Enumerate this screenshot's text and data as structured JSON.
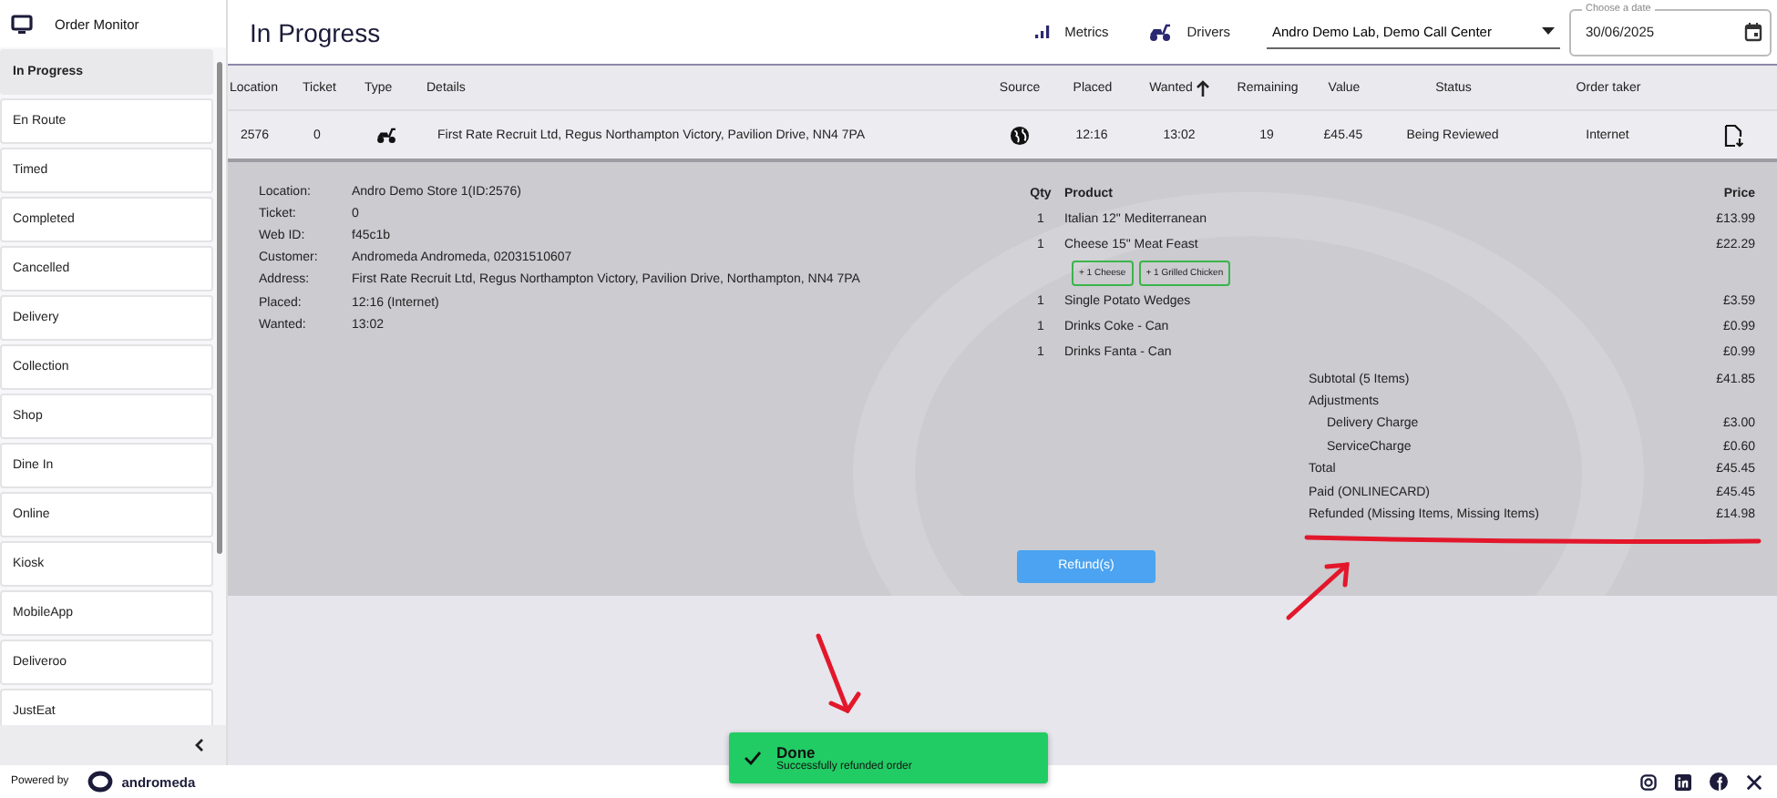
{
  "sidebar": {
    "title": "Order Monitor",
    "items": [
      {
        "label": "In Progress",
        "selected": true
      },
      {
        "label": "En Route",
        "selected": false
      },
      {
        "label": "Timed",
        "selected": false
      },
      {
        "label": "Completed",
        "selected": false
      },
      {
        "label": "Cancelled",
        "selected": false
      },
      {
        "label": "Delivery",
        "selected": false
      },
      {
        "label": "Collection",
        "selected": false
      },
      {
        "label": "Shop",
        "selected": false
      },
      {
        "label": "Dine In",
        "selected": false
      },
      {
        "label": "Online",
        "selected": false
      },
      {
        "label": "Kiosk",
        "selected": false
      },
      {
        "label": "MobileApp",
        "selected": false
      },
      {
        "label": "Deliveroo",
        "selected": false
      },
      {
        "label": "JustEat",
        "selected": false
      }
    ]
  },
  "header": {
    "title": "In Progress",
    "metrics": "Metrics",
    "drivers": "Drivers",
    "store_select": "Andro Demo Lab, Demo Call Center",
    "date_field": {
      "label": "Choose a date",
      "value": "30/06/2025"
    }
  },
  "table": {
    "columns": [
      "Location",
      "Ticket",
      "Type",
      "Details",
      "Source",
      "Placed",
      "Wanted",
      "Remaining",
      "Value",
      "Status",
      "Order taker"
    ],
    "rows": [
      {
        "location": "2576",
        "ticket": "0",
        "details": "First Rate Recruit Ltd, Regus Northampton Victory, Pavilion Drive, NN4 7PA",
        "placed": "12:16",
        "wanted": "13:02",
        "remaining": "19",
        "value": "£45.45",
        "status": "Being Reviewed",
        "order_taker": "Internet"
      }
    ]
  },
  "order_details": {
    "fields": [
      {
        "label": "Location:",
        "value": "Andro Demo Store 1(ID:2576)"
      },
      {
        "label": "Ticket:",
        "value": "0"
      },
      {
        "label": "Web ID:",
        "value": "f45c1b"
      },
      {
        "label": "Customer:",
        "value": "Andromeda Andromeda, 02031510607"
      },
      {
        "label": "Address:",
        "value": "First Rate Recruit Ltd, Regus Northampton Victory, Pavilion Drive, Northampton, NN4 7PA"
      },
      {
        "label": "Placed:",
        "value": "12:16  (Internet)"
      },
      {
        "label": "Wanted:",
        "value": "13:02"
      }
    ],
    "items_header": {
      "qty": "Qty",
      "product": "Product",
      "price": "Price"
    },
    "items": [
      {
        "qty": "1",
        "product": "Italian 12\" Mediterranean",
        "price": "£13.99"
      },
      {
        "qty": "1",
        "product": "Cheese 15\" Meat Feast",
        "price": "£22.29",
        "toppings": [
          "+ 1 Cheese",
          "+ 1 Grilled Chicken"
        ]
      },
      {
        "qty": "1",
        "product": "Single Potato Wedges",
        "price": "£3.59"
      },
      {
        "qty": "1",
        "product": "Drinks Coke - Can",
        "price": "£0.99"
      },
      {
        "qty": "1",
        "product": "Drinks Fanta - Can",
        "price": "£0.99"
      }
    ],
    "summary": [
      {
        "kind": "line",
        "label": "Subtotal (5 Items)",
        "value": "£41.85"
      },
      {
        "kind": "heading",
        "label": "Adjustments"
      },
      {
        "kind": "sub",
        "label": "Delivery Charge",
        "value": "£3.00"
      },
      {
        "kind": "sub",
        "label": "ServiceCharge",
        "value": "£0.60"
      },
      {
        "kind": "line",
        "label": "Total",
        "value": "£45.45"
      },
      {
        "kind": "line",
        "label": "Paid (ONLINECARD)",
        "value": "£45.45"
      },
      {
        "kind": "line",
        "label": "Refunded (Missing Items, Missing Items)",
        "value": "£14.98"
      }
    ],
    "refund_button": "Refund(s)"
  },
  "toast": {
    "title": "Done",
    "message": "Successfully refunded order"
  },
  "footer": {
    "powered_by": "Powered by",
    "brand": "andromeda"
  },
  "annotations": [
    {
      "kind": "underline"
    },
    {
      "kind": "arrow"
    },
    {
      "kind": "arrow"
    }
  ]
}
